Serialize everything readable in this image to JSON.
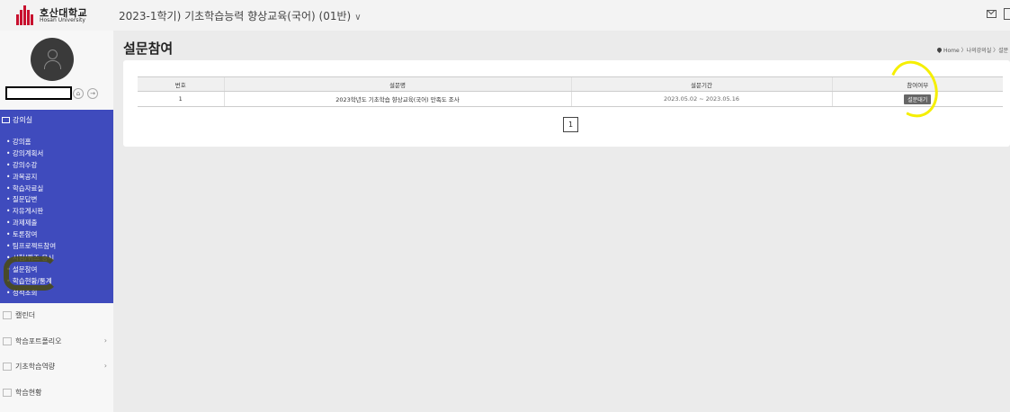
{
  "brand": {
    "name_ko": "호산대학교",
    "name_en": "Hosan University",
    "brand_color": "#c8102e"
  },
  "header": {
    "course_title": "2023-1학기) 기초학습능력 향상교육(국어) (01반)",
    "dropdown_glyph": "∨"
  },
  "profile": {
    "icons": [
      "home-icon",
      "logout-icon"
    ]
  },
  "sidebar": {
    "section_title": "강의실",
    "accent_color": "#3f4bbd",
    "items": [
      {
        "label": "강의홈"
      },
      {
        "label": "강의계획서"
      },
      {
        "label": "강의수강"
      },
      {
        "label": "과목공지"
      },
      {
        "label": "학습자료실"
      },
      {
        "label": "질문답변"
      },
      {
        "label": "자유게시판"
      },
      {
        "label": "과제제출"
      },
      {
        "label": "토론참여"
      },
      {
        "label": "팀프로젝트참여"
      },
      {
        "label": "시험/퀴즈 응시"
      },
      {
        "label": "설문참여"
      },
      {
        "label": "학습현황/통계"
      },
      {
        "label": "성적조회"
      }
    ],
    "extra": [
      {
        "label": "캘린더",
        "icon": "calendar-icon"
      },
      {
        "label": "학습포트폴리오",
        "icon": "portfolio-icon",
        "arrow": "›"
      },
      {
        "label": "기초학습역량",
        "icon": "pencil-icon",
        "arrow": "›"
      },
      {
        "label": "학습현황",
        "icon": "bar-chart-icon"
      }
    ]
  },
  "main": {
    "page_title": "설문참여",
    "breadcrumb": "Home 〉나의강의실 〉설문",
    "table": {
      "headers": [
        "번호",
        "설문명",
        "설문기간",
        "참여여부"
      ],
      "rows": [
        {
          "no": "1",
          "name": "2023학년도 기초학습 향상교육(국어) 만족도 조사",
          "period": "2023.05.02 ~ 2023.05.16",
          "status": "설문대기"
        }
      ]
    },
    "pagination": {
      "current": "1"
    },
    "highlight_color": "#f5ef00"
  }
}
